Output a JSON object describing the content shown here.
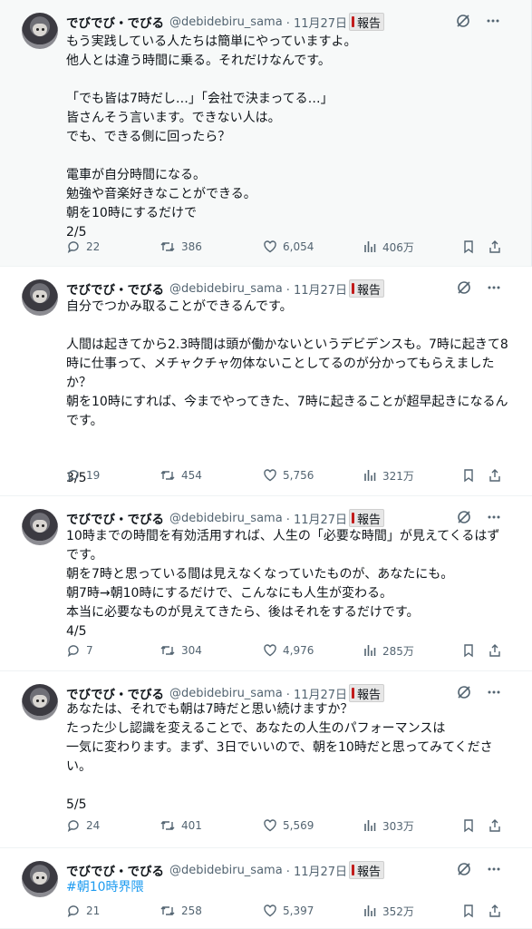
{
  "tweets": [
    {
      "author": "でびでび・でびる",
      "handle": "@debidebiru_sama",
      "date": "· 11月27日",
      "report": "報告",
      "text": "もう実践している人たちは簡単にやっていますよ。\n他人とは違う時間に乗る。それだけなんです。\n\n「でも皆は7時だし…」「会社で決まってる…」\n皆さんそう言います。できない人は。\nでも、できる側に回ったら？\n\n電車が自分時間になる。\n勉強や音楽好きなことができる。\n朝を10時にするだけで\n2/5",
      "replies": "22",
      "retweets": "386",
      "likes": "6,054",
      "views": "406万"
    },
    {
      "author": "でびでび・でびる",
      "handle": "@debidebiru_sama",
      "date": "· 11月27日",
      "report": "報告",
      "text": "自分でつかみ取ることができるんです。\n\n人間は起きてから2.3時間は頭が働かないというデビデンスも。7時に起きて8時に仕事って、メチャクチャ勿体ないことしてるのが分かってもらえましたか？\n朝を10時にすれば、今までやってきた、7時に起きることが超早起きになるんです。\n\n\n3/5",
      "replies": "19",
      "retweets": "454",
      "likes": "5,756",
      "views": "321万"
    },
    {
      "author": "でびでび・でびる",
      "handle": "@debidebiru_sama",
      "date": "· 11月27日",
      "report": "報告",
      "text": "10時までの時間を有効活用すれば、人生の「必要な時間」が見えてくるはずです。\n朝を7時と思っている間は見えなくなっていたものが、あなたにも。\n朝7時→朝10時にするだけで、こんなにも人生が変わる。\n本当に必要なものが見えてきたら、後はそれをするだけです。\n4/5",
      "replies": "7",
      "retweets": "304",
      "likes": "4,976",
      "views": "285万"
    },
    {
      "author": "でびでび・でびる",
      "handle": "@debidebiru_sama",
      "date": "· 11月27日",
      "report": "報告",
      "text": "あなたは、それでも朝は7時だと思い続けますか？\nたった少し認識を変えることで、あなたの人生のパフォーマンスは\n一気に変わります。まず、3日でいいので、朝を10時だと思ってみてください。\n\n5/5",
      "replies": "24",
      "retweets": "401",
      "likes": "5,569",
      "views": "303万"
    },
    {
      "author": "でびでび・でびる",
      "handle": "@debidebiru_sama",
      "date": "· 11月27日",
      "report": "報告",
      "text": "#朝10時界隈",
      "replies": "21",
      "retweets": "258",
      "likes": "5,397",
      "views": "352万"
    }
  ],
  "colors": {
    "link": "#1d9bf0",
    "muted": "#536471",
    "text": "#0f1419"
  },
  "icons": [
    "grok-icon",
    "more-icon",
    "reply-icon",
    "retweet-icon",
    "like-icon",
    "views-icon",
    "bookmark-icon",
    "share-icon"
  ]
}
